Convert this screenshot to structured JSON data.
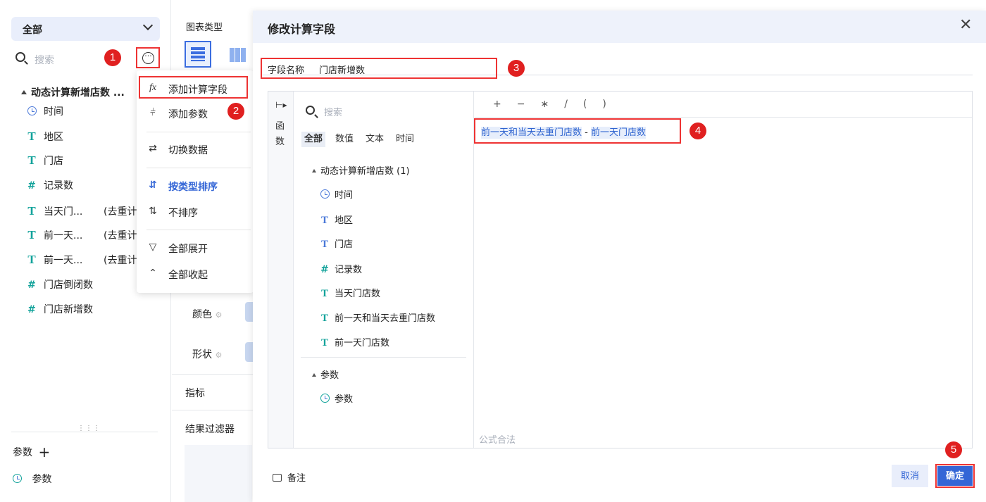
{
  "left_panel": {
    "dataset_select": "全部",
    "search_placeholder": "搜索",
    "tree_title": "动态计算新增店数 ...",
    "fields": [
      {
        "label": "时间",
        "icon": "clock-icon",
        "glyph": ""
      },
      {
        "label": "地区",
        "icon": "text-type-icon",
        "glyph": "T"
      },
      {
        "label": "门店",
        "icon": "text-type-icon",
        "glyph": "T"
      },
      {
        "label": "记录数",
        "icon": "number-type-icon",
        "glyph": "#"
      },
      {
        "label": "当天门...",
        "suffix": "(去重计",
        "icon": "text-type-icon",
        "glyph": "T"
      },
      {
        "label": "前一天...",
        "suffix": "(去重计",
        "icon": "text-type-icon",
        "glyph": "T"
      },
      {
        "label": "前一天...",
        "suffix": "(去重计",
        "icon": "text-type-icon",
        "glyph": "T"
      },
      {
        "label": "门店倒闭数",
        "icon": "calc-number-icon",
        "glyph": "#"
      },
      {
        "label": "门店新增数",
        "icon": "calc-number-icon",
        "glyph": "#"
      }
    ],
    "params_label": "参数",
    "params_add": "+",
    "param_item": "参数"
  },
  "mid_panel": {
    "chart_type_label": "图表类型",
    "color_label": "颜色",
    "shape_label": "形状",
    "metric_label": "指标",
    "result_filter_label": "结果过滤器"
  },
  "menu": {
    "items": [
      {
        "label": "添加计算字段",
        "icon": "fx"
      },
      {
        "label": "添加参数",
        "icon": "⫩"
      },
      {
        "label": "切换数据",
        "icon": "⇄"
      },
      {
        "label": "按类型排序",
        "icon": "⇵"
      },
      {
        "label": "不排序",
        "icon": "⇅"
      },
      {
        "label": "全部展开",
        "icon": "▽"
      },
      {
        "label": "全部收起",
        "icon": "⌃"
      }
    ]
  },
  "badges": [
    "1",
    "2",
    "3",
    "4",
    "5"
  ],
  "modal": {
    "title": "修改计算字段",
    "close": "✕",
    "field_name_label": "字段名称",
    "field_name_value": "门店新增数",
    "fn_tab": [
      "函",
      "数"
    ],
    "search_placeholder": "搜索",
    "filters": [
      "全部",
      "数值",
      "文本",
      "时间"
    ],
    "group_title": "动态计算新增店数 (1)",
    "list_items": [
      {
        "label": "时间",
        "glyph": ""
      },
      {
        "label": "地区",
        "glyph": "T"
      },
      {
        "label": "门店",
        "glyph": "T"
      },
      {
        "label": "记录数",
        "glyph": "#"
      },
      {
        "label": "当天门店数",
        "glyph": "T"
      },
      {
        "label": "前一天和当天去重门店数",
        "glyph": "T"
      },
      {
        "label": "前一天门店数",
        "glyph": "T"
      }
    ],
    "params_group": "参数",
    "param_item": "参数",
    "operators": [
      "+",
      "−",
      "∗",
      "/",
      "(",
      ")"
    ],
    "formula": {
      "token1": "前一天和当天去重门店数",
      "op": " - ",
      "token2": "前一天门店数"
    },
    "validity": "公式合法",
    "note": "备注",
    "cancel": "取消",
    "confirm": "确定"
  },
  "colors": {
    "accent": "#3466d6",
    "highlight_red": "#e33333",
    "text_type_teal": "#13a39b"
  }
}
